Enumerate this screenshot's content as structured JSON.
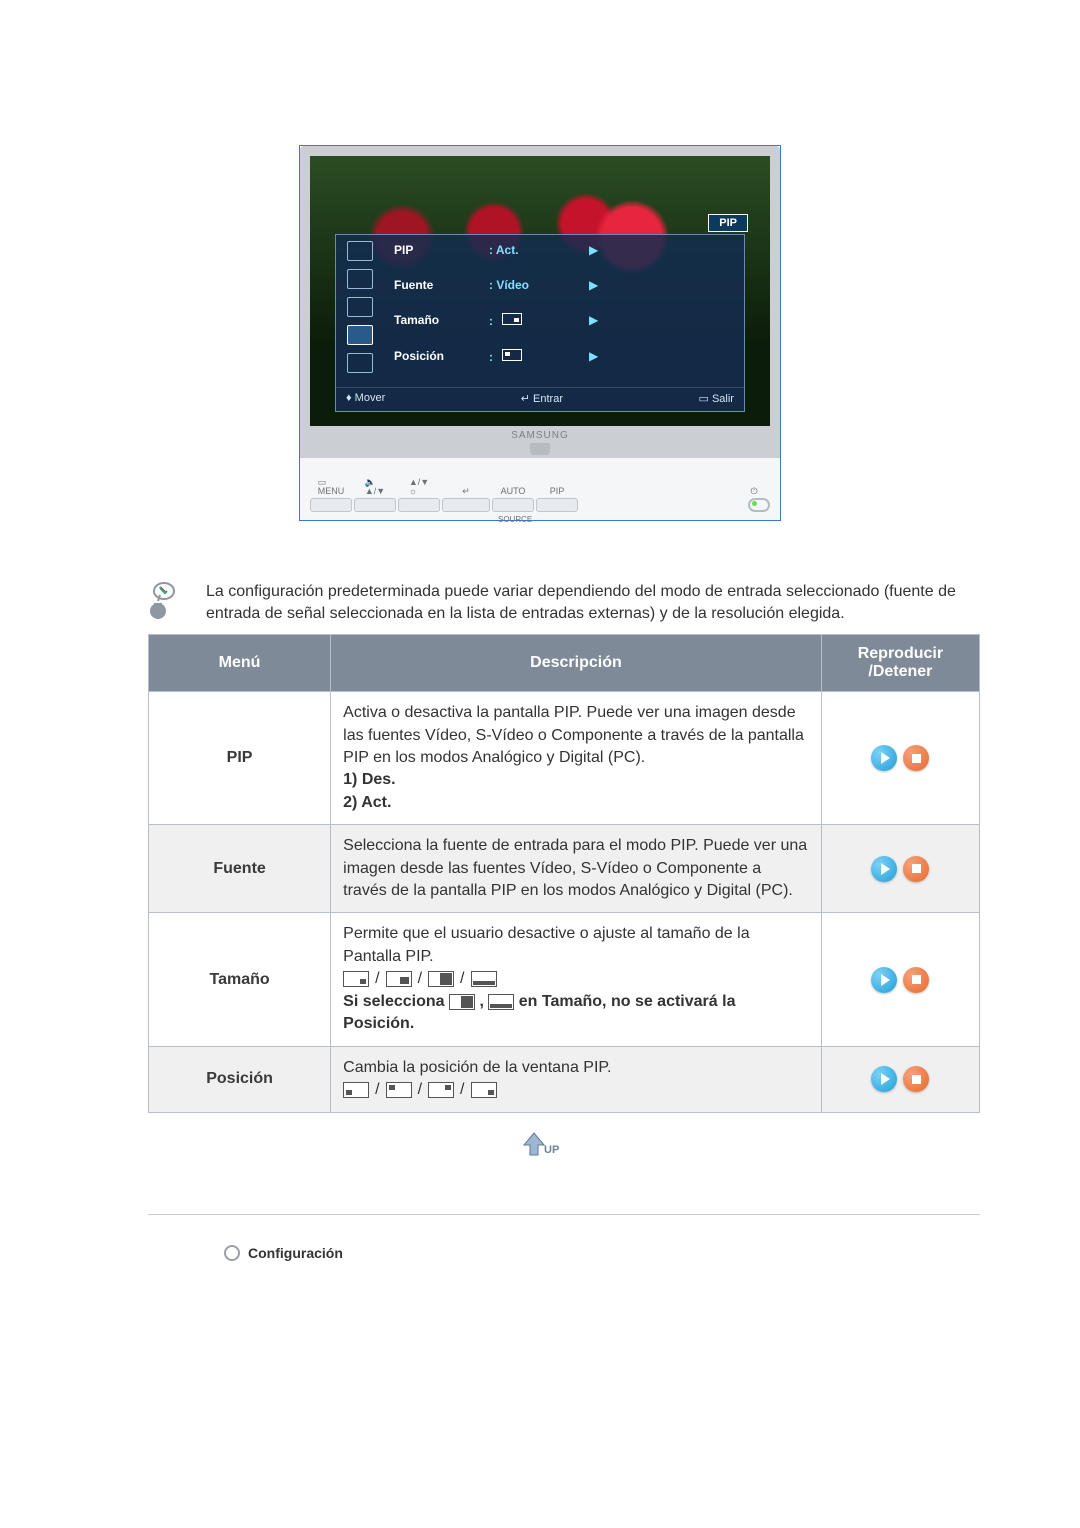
{
  "monitor": {
    "pip_badge": "PIP",
    "rows": {
      "pip_label": "PIP",
      "pip_value": "Act.",
      "fuente_label": "Fuente",
      "fuente_value": "Vídeo",
      "tamano_label": "Tamaño",
      "posicion_label": "Posición"
    },
    "footer": {
      "mover": "Mover",
      "entrar": "Entrar",
      "salir": "Salir"
    },
    "brand": "SAMSUNG",
    "bezel": {
      "menu": "MENU",
      "updown_sym": "▲/▼",
      "enter_sym": "↵",
      "auto": "AUTO",
      "pip": "PIP",
      "source_sub": "SOURCE",
      "bright_sym": "☼",
      "power_sym": "⏻"
    }
  },
  "note": "La configuración predeterminada puede variar dependiendo del modo de entrada seleccionado (fuente de entrada de señal seleccionada en la lista de entradas externas) y de la resolución elegida.",
  "table": {
    "headers": {
      "menu": "Menú",
      "desc": "Descripción",
      "media": "Reproducir /Detener"
    },
    "rows": {
      "pip": {
        "menu": "PIP",
        "desc_p1": "Activa o desactiva la pantalla PIP. Puede ver una imagen desde las fuentes Vídeo, S-Vídeo o Componente a través de la pantalla PIP en los modos Analógico y Digital (PC).",
        "opt1": "1) Des.",
        "opt2": "2) Act."
      },
      "fuente": {
        "menu": "Fuente",
        "desc": "Selecciona la fuente de entrada para el modo PIP. Puede ver una imagen desde las fuentes Vídeo, S-Vídeo o Componente a través de la pantalla PIP en los modos Analógico y Digital (PC)."
      },
      "tamano": {
        "menu": "Tamaño",
        "desc_p1": "Permite que el usuario desactive o ajuste al tamaño de la Pantalla PIP.",
        "warn_pre": "Si selecciona ",
        "warn_mid": ", ",
        "warn_post": " en Tamaño, no se activará la Posición."
      },
      "posicion": {
        "menu": "Posición",
        "desc": "Cambia la posición de la ventana PIP."
      }
    }
  },
  "up_label": "UP",
  "section": "Configuración"
}
